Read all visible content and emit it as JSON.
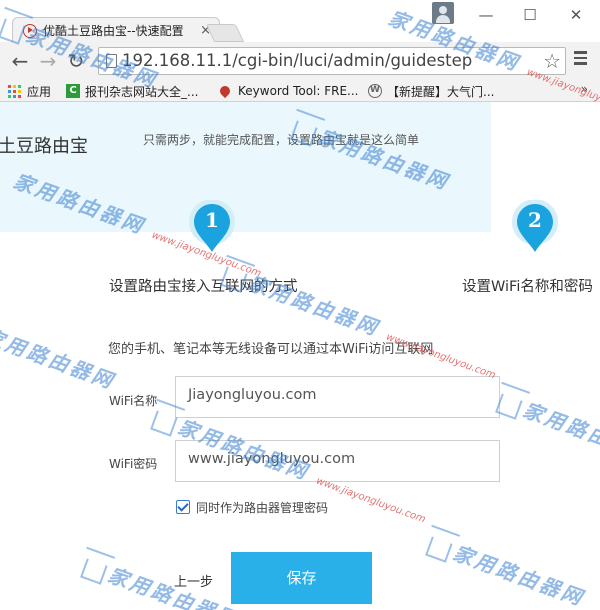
{
  "browser": {
    "tab_title": "优酷土豆路由宝--快速配置",
    "tab_close": "×",
    "url": "192.168.11.1/cgi-bin/luci/admin/guidestep",
    "window_controls": {
      "minimize": "—",
      "maximize": "☐",
      "close": "✕"
    },
    "nav": {
      "back": "←",
      "forward": "→",
      "reload": "↻"
    },
    "star": "☆",
    "bookmarks": [
      {
        "label": "应用",
        "icon": "apps-grid-icon"
      },
      {
        "label": "报刊杂志网站大全_...",
        "icon": "green-c-icon"
      },
      {
        "label": "Keyword Tool: FRE...",
        "icon": "keyword-tool-icon"
      },
      {
        "label": "【新提醒】大气门...",
        "icon": "wordpress-icon"
      }
    ],
    "bookmarks_more": "»"
  },
  "page": {
    "brand": "土豆路由宝",
    "tagline": "只需两步，就能完成配置，设置路由宝就是这么简单",
    "steps": [
      {
        "number": "1",
        "label": "设置路由宝接入互联网的方式"
      },
      {
        "number": "2",
        "label": "设置WiFi名称和密码"
      }
    ],
    "description": "您的手机、笔记本等无线设备可以通过本WiFi访问互联网",
    "wifi_name": {
      "label": "WiFi名称",
      "value": "Jiayongluyou.com"
    },
    "wifi_password": {
      "label": "WiFi密码",
      "value": "www.jiayongluyou.com"
    },
    "admin_password_checkbox": {
      "label": "同时作为路由器管理密码",
      "checked": true
    },
    "prev_label": "上一步",
    "save_label": "保存",
    "accent_color": "#29b0e8"
  },
  "watermark": {
    "text": "家用路由器网",
    "url": "www.jiayongluyou.com"
  }
}
